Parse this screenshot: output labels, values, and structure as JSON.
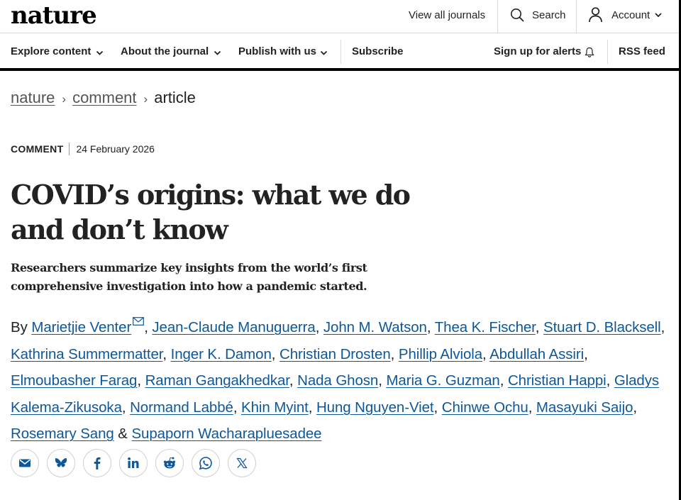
{
  "header": {
    "logo": "nature",
    "view_all_journals": "View all journals",
    "search": "Search",
    "account": "Account"
  },
  "nav": {
    "explore": "Explore content",
    "about": "About the journal",
    "publish": "Publish with us",
    "subscribe": "Subscribe",
    "alerts": "Sign up for alerts",
    "rss": "RSS feed"
  },
  "breadcrumb": {
    "items": [
      "nature",
      "comment",
      "article"
    ],
    "separator": "›"
  },
  "article": {
    "type": "COMMENT",
    "date": "24 February 2026",
    "title_line1": "COVID’s origins: what we do",
    "title_line2": "and don’t know",
    "standfirst_line1": "Researchers summarize key insights from the world’s first",
    "standfirst_line2": "comprehensive investigation into how a pandemic started.",
    "by": "By",
    "authors": [
      "Marietjie Venter",
      "Jean-Claude Manuguerra",
      "John M. Watson",
      "Thea K. Fischer",
      "Stuart D. Blacksell",
      "Kathrina Summermatter",
      "Inger K. Damon",
      "Christian Drosten",
      "Phillip Alviola",
      "Abdullah Assiri",
      "Elmoubasher Farag",
      "Raman Gangakhedkar",
      "Nada Ghosn",
      "Maria G. Guzman",
      "Christian Happi",
      "Gladys Kalema-Zikusoka",
      "Normand Labbé",
      "Khin Myint",
      "Hung Nguyen-Viet",
      "Chinwe Ochu",
      "Masayuki Saijo",
      "Rosemary Sang",
      "Supaporn Wacharapluesadee"
    ],
    "comma": ",",
    "ampersand": "&"
  },
  "share": {
    "icons": [
      "email-icon",
      "bluesky-icon",
      "facebook-icon",
      "linkedin-icon",
      "reddit-icon",
      "whatsapp-icon",
      "x-icon"
    ]
  },
  "colors": {
    "link": "#0e5799",
    "text": "#222222",
    "border": "#dadada"
  }
}
